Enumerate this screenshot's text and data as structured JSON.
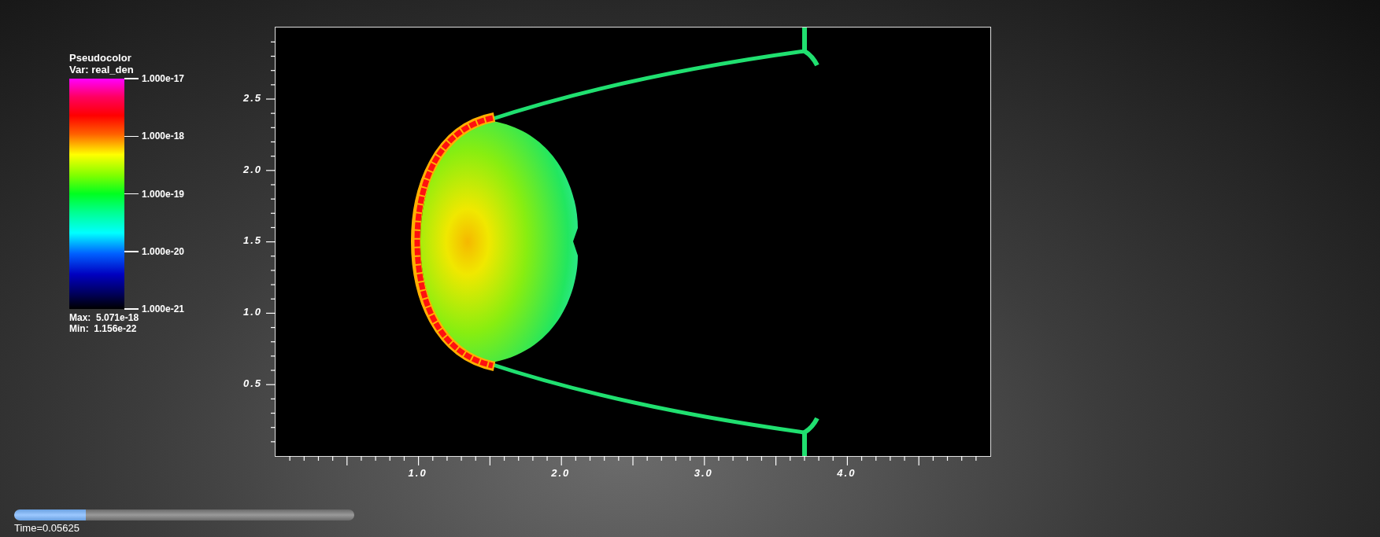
{
  "legend": {
    "title": "Pseudocolor",
    "variable": "Var: real_den",
    "ticks": [
      "1.000e-17",
      "1.000e-18",
      "1.000e-19",
      "1.000e-20",
      "1.000e-21"
    ],
    "max": "Max:  5.071e-18",
    "min": "Min:  1.156e-22"
  },
  "plot": {
    "y_ticks": [
      "2.5",
      "2.0",
      "1.5",
      "1.0",
      "0.5"
    ],
    "x_ticks": [
      "1.0",
      "2.0",
      "3.0",
      "4.0"
    ]
  },
  "time_slider": {
    "level": 0.21,
    "label": "Time=0.05625"
  }
}
